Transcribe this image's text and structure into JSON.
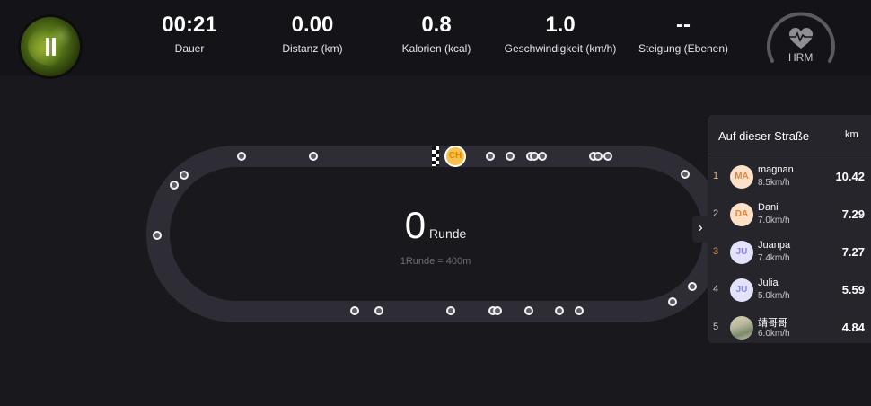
{
  "header": {
    "stats": [
      {
        "value": "00:21",
        "label": "Dauer"
      },
      {
        "value": "0.00",
        "label": "Distanz (km)"
      },
      {
        "value": "0.8",
        "label": "Kalorien (kcal)"
      },
      {
        "value": "1.0",
        "label": "Geschwindigkeit (km/h)"
      },
      {
        "value": "--",
        "label": "Steigung (Ebenen)"
      }
    ],
    "hrm_label": "HRM"
  },
  "track": {
    "laps_value": "0",
    "laps_unit": "Runde",
    "lap_hint": "1Runde = 400m",
    "me_initials": "CH"
  },
  "leaderboard": {
    "title": "Auf dieser Straße",
    "unit": "km",
    "toggle_icon": "chevron-right-icon",
    "rows": [
      {
        "rank": "1",
        "initials": "MA",
        "name": "magnan",
        "speed": "8.5km/h",
        "km": "10.42"
      },
      {
        "rank": "2",
        "initials": "DA",
        "name": "Dani",
        "speed": "7.0km/h",
        "km": "7.29"
      },
      {
        "rank": "3",
        "initials": "JU",
        "name": "Juanpa",
        "speed": "7.4km/h",
        "km": "7.27"
      },
      {
        "rank": "4",
        "initials": "JU",
        "name": "Julia",
        "speed": "5.0km/h",
        "km": "5.59"
      },
      {
        "rank": "5",
        "initials": "",
        "name": "靖哥哥",
        "speed": "6.0km/h",
        "km": "4.84"
      }
    ]
  },
  "colors": {
    "background": "#19181d",
    "track": "#2e2d36",
    "accent_gold": "#f6c14e",
    "avatar_orange": "#fbe1c7",
    "avatar_lavender": "#e3e2fb"
  }
}
